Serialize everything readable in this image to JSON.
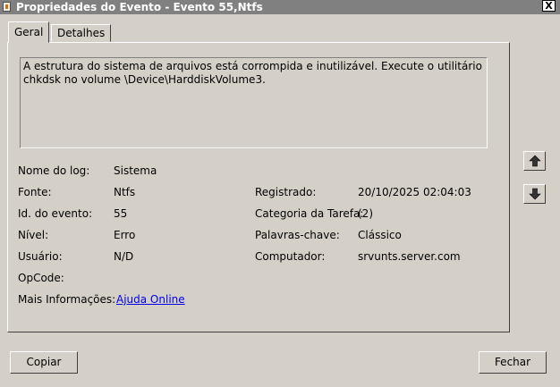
{
  "window": {
    "title": "Propriedades do Evento - Evento 55,Ntfs",
    "close_label": "X"
  },
  "tabs": [
    {
      "label": "Geral",
      "active": true
    },
    {
      "label": "Detalhes",
      "active": false
    }
  ],
  "description": "A estrutura do sistema de arquivos está corrompida e inutilizável. Execute o utilitário chkdsk no volume \\Device\\HarddiskVolume3.",
  "fields": {
    "log_name": {
      "label": "Nome do log:",
      "value": "Sistema"
    },
    "source": {
      "label": "Fonte:",
      "value": "Ntfs"
    },
    "logged": {
      "label": "Registrado:",
      "value": "20/10/2025 02:04:03"
    },
    "event_id": {
      "label": "Id. do evento:",
      "value": "55"
    },
    "task_category": {
      "label": "Categoria da Tarefa:",
      "value": "(2)"
    },
    "level": {
      "label": "Nível:",
      "value": "Erro"
    },
    "keywords": {
      "label": "Palavras-chave:",
      "value": "Clássico"
    },
    "user": {
      "label": "Usuário:",
      "value": "N/D"
    },
    "computer": {
      "label": "Computador:",
      "value": "srvunts.server.com"
    },
    "opcode": {
      "label": "OpCode:",
      "value": ""
    },
    "more_info": {
      "label": "Mais Informações:",
      "link": "Ajuda Online"
    }
  },
  "buttons": {
    "copy": "Copiar",
    "close": "Fechar"
  },
  "icons": {
    "up": "arrow-up-icon",
    "down": "arrow-down-icon"
  }
}
